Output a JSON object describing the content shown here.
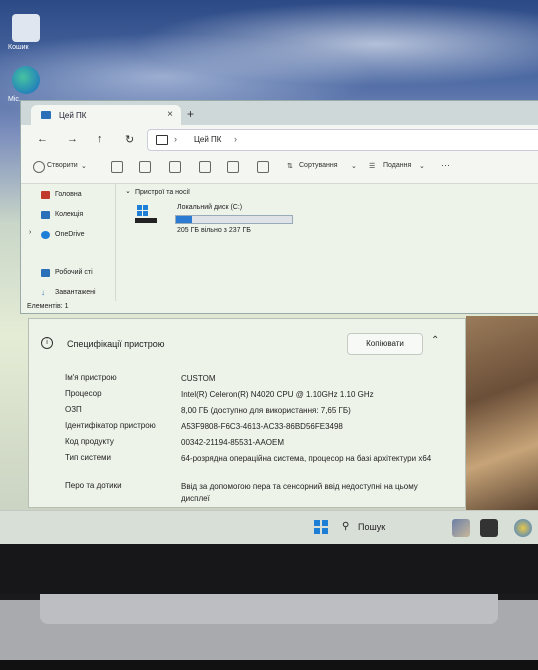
{
  "desktop": {
    "recycle_label": "Кошик",
    "edge_label": "Mic..."
  },
  "explorer": {
    "tab_title": "Цей ПК",
    "tab_close": "×",
    "new_tab": "+",
    "nav": {
      "back": "←",
      "forward": "→",
      "up": "↑",
      "refresh": "↻"
    },
    "breadcrumb": [
      "Цей ПК"
    ],
    "toolbar": {
      "create": "Створити",
      "sort": "Сортування",
      "view": "Подання",
      "more": "···"
    },
    "nav_pane": [
      {
        "label": "Головна",
        "icon": "home-icon",
        "color": "#c0392b"
      },
      {
        "label": "Колекція",
        "icon": "gallery-icon",
        "color": "#2a6fb8"
      },
      {
        "label": "OneDrive",
        "icon": "cloud-icon",
        "color": "#1f7fd6"
      },
      {
        "label": "Робочий сті",
        "icon": "desktop-icon",
        "color": "#2a6fb8"
      },
      {
        "label": "Завантажені",
        "icon": "download-icon",
        "color": "#2a6fb8"
      }
    ],
    "section_title": "Пристрої та носії",
    "drive": {
      "name": "Локальний диск (C:)",
      "free_text": "205 ГБ вільно з 237 ГБ",
      "used_fraction": 0.135
    },
    "status": "Елементів: 1"
  },
  "specs": {
    "title": "Специфікації пристрою",
    "copy_label": "Копіювати",
    "rows": [
      {
        "k": "Ім'я пристрою",
        "v": "CUSTOM"
      },
      {
        "k": "Процесор",
        "v": "Intel(R) Celeron(R) N4020 CPU @ 1.10GHz   1.10 GHz"
      },
      {
        "k": "ОЗП",
        "v": "8,00 ГБ (доступно для використання: 7,65 ГБ)"
      },
      {
        "k": "Ідентифікатор пристрою",
        "v": "A53F9808-F6C3-4613-AC33-86BD56FE3498"
      },
      {
        "k": "Код продукту",
        "v": "00342-21194-85531-AAOEM"
      },
      {
        "k": "Тип системи",
        "v": "64-розрядна операційна система, процесор на базі архітектури x64"
      },
      {
        "k": "Перо та дотики",
        "v": "Ввід за допомогою пера та сенсорний ввід недоступні на цьому дисплеї"
      }
    ]
  },
  "taskbar": {
    "search_label": "Пошук"
  }
}
